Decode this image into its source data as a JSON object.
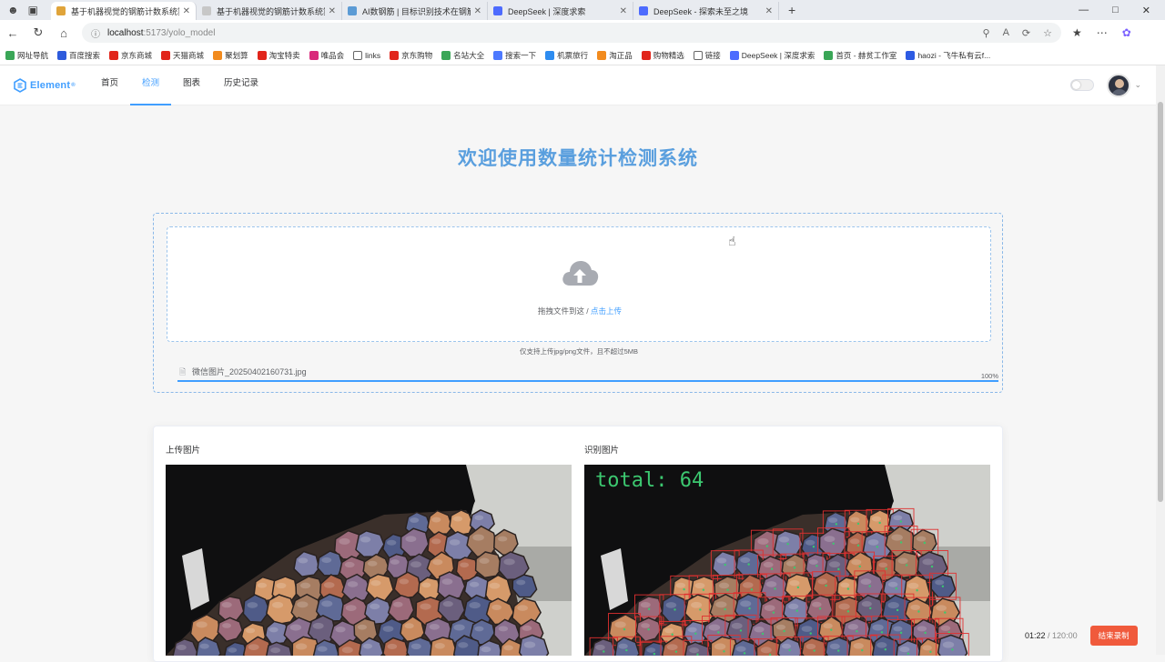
{
  "browser": {
    "tabs": [
      {
        "title": "基于机器视觉的钢筋计数系统算...",
        "color": "#e0a43a",
        "active": true
      },
      {
        "title": "基于机器视觉的钢筋计数系统算...",
        "color": "#c7c7c7",
        "active": false
      },
      {
        "title": "AI数钢筋 | 目标识别技术在钢筋...",
        "color": "#5b9bd5",
        "active": false
      },
      {
        "title": "DeepSeek | 深度求索",
        "color": "#4d6bfe",
        "active": false
      },
      {
        "title": "DeepSeek - 探索未至之境",
        "color": "#4d6bfe",
        "active": false
      }
    ],
    "new_tab": "+",
    "url_host": "localhost",
    "url_path": ":5173/yolo_model",
    "bookmarks": [
      {
        "label": "网址导航",
        "color": "#3aa657"
      },
      {
        "label": "百度搜索",
        "color": "#2e5bdc"
      },
      {
        "label": "京东商城",
        "color": "#e1251b"
      },
      {
        "label": "天猫商城",
        "color": "#e1251b"
      },
      {
        "label": "聚划算",
        "color": "#f28b1e"
      },
      {
        "label": "淘宝特卖",
        "color": "#e1251b"
      },
      {
        "label": "唯品会",
        "color": "#d9297b"
      },
      {
        "label": "links",
        "color": "#ffffff"
      },
      {
        "label": "京东购物",
        "color": "#e1251b"
      },
      {
        "label": "名站大全",
        "color": "#3aa657"
      },
      {
        "label": "搜索一下",
        "color": "#4d79ff"
      },
      {
        "label": "机票旅行",
        "color": "#2d8cf0"
      },
      {
        "label": "淘正品",
        "color": "#f28b1e"
      },
      {
        "label": "购物精选",
        "color": "#e1251b"
      },
      {
        "label": "链接",
        "color": "#ffffff"
      },
      {
        "label": "DeepSeek | 深度求索",
        "color": "#4d6bfe"
      },
      {
        "label": "首页 - 赫贫工作室",
        "color": "#3aa657"
      },
      {
        "label": "haozi - 飞牛私有云f...",
        "color": "#2d5be3"
      }
    ]
  },
  "app": {
    "logo_text": "Element",
    "menu": [
      "首页",
      "检测",
      "图表",
      "历史记录"
    ],
    "active_menu_index": 1,
    "accent": "#409eff"
  },
  "page": {
    "title": "欢迎使用数量统计检测系统",
    "upload": {
      "drop_text": "拖拽文件到这 / ",
      "click_text": "点击上传",
      "tip": "仅支持上传jpg/png文件，且不超过5MB",
      "file_name": "微信图片_20250402160731.jpg",
      "progress_label": "100%",
      "progress": 1.0
    },
    "result": {
      "upload_label": "上传图片",
      "detect_label": "识别图片",
      "total_text": "total: 64"
    }
  },
  "recorder": {
    "elapsed": "01:22",
    "separator": " / ",
    "total": "120:00",
    "stop_label": "结束录制"
  }
}
